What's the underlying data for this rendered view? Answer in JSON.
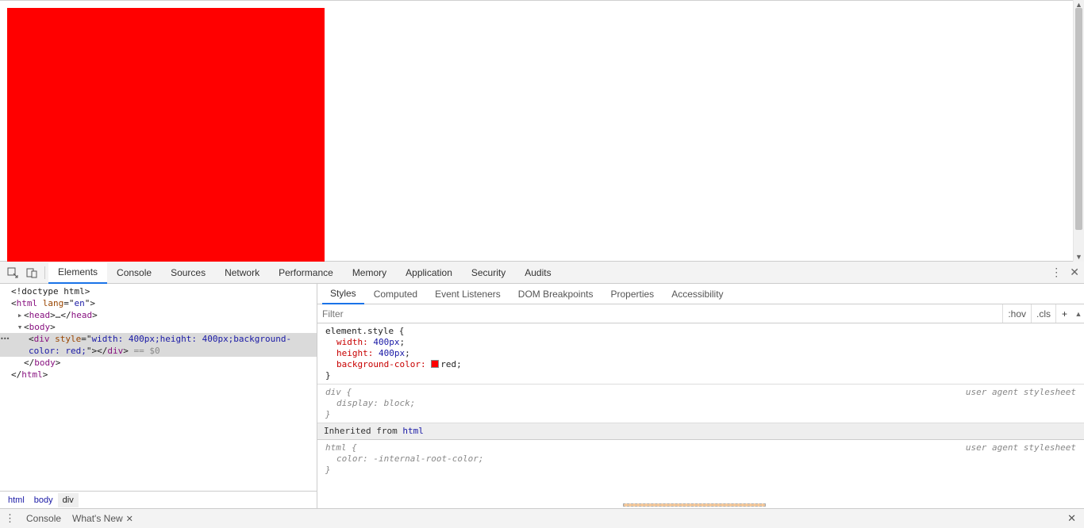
{
  "viewport": {
    "box_color": "red"
  },
  "tabs": {
    "elements": "Elements",
    "console": "Console",
    "sources": "Sources",
    "network": "Network",
    "performance": "Performance",
    "memory": "Memory",
    "application": "Application",
    "security": "Security",
    "audits": "Audits"
  },
  "dom": {
    "doctype": "<!doctype html>",
    "html_open": "<html lang=\"en\">",
    "head": "<head>…</head>",
    "body_open": "<body>",
    "div_line": "<div style=\"width: 400px;height: 400px;background-color: red;\"></div> == $0",
    "body_close": "</body>",
    "html_close": "</html>"
  },
  "breadcrumb": {
    "html": "html",
    "body": "body",
    "div": "div"
  },
  "subtabs": {
    "styles": "Styles",
    "computed": "Computed",
    "eventlisteners": "Event Listeners",
    "dombreak": "DOM Breakpoints",
    "properties": "Properties",
    "accessibility": "Accessibility"
  },
  "filter": {
    "placeholder": "Filter",
    "hov": ":hov",
    "cls": ".cls",
    "plus": "+"
  },
  "styles": {
    "element_style_sel": "element.style {",
    "width_prop": "width",
    "width_val": "400px",
    "height_prop": "height",
    "height_val": "400px",
    "bg_prop": "background-color",
    "bg_val": "red",
    "close_brace": "}",
    "div_sel": "div {",
    "display_prop": "display",
    "display_val": "block",
    "ua_hint": "user agent stylesheet",
    "inherited_label": "Inherited from ",
    "inherited_link": "html",
    "html_sel": "html {",
    "color_prop": "color",
    "color_val": "-internal-root-color"
  },
  "drawer": {
    "console": "Console",
    "whatsnew": "What's New"
  }
}
